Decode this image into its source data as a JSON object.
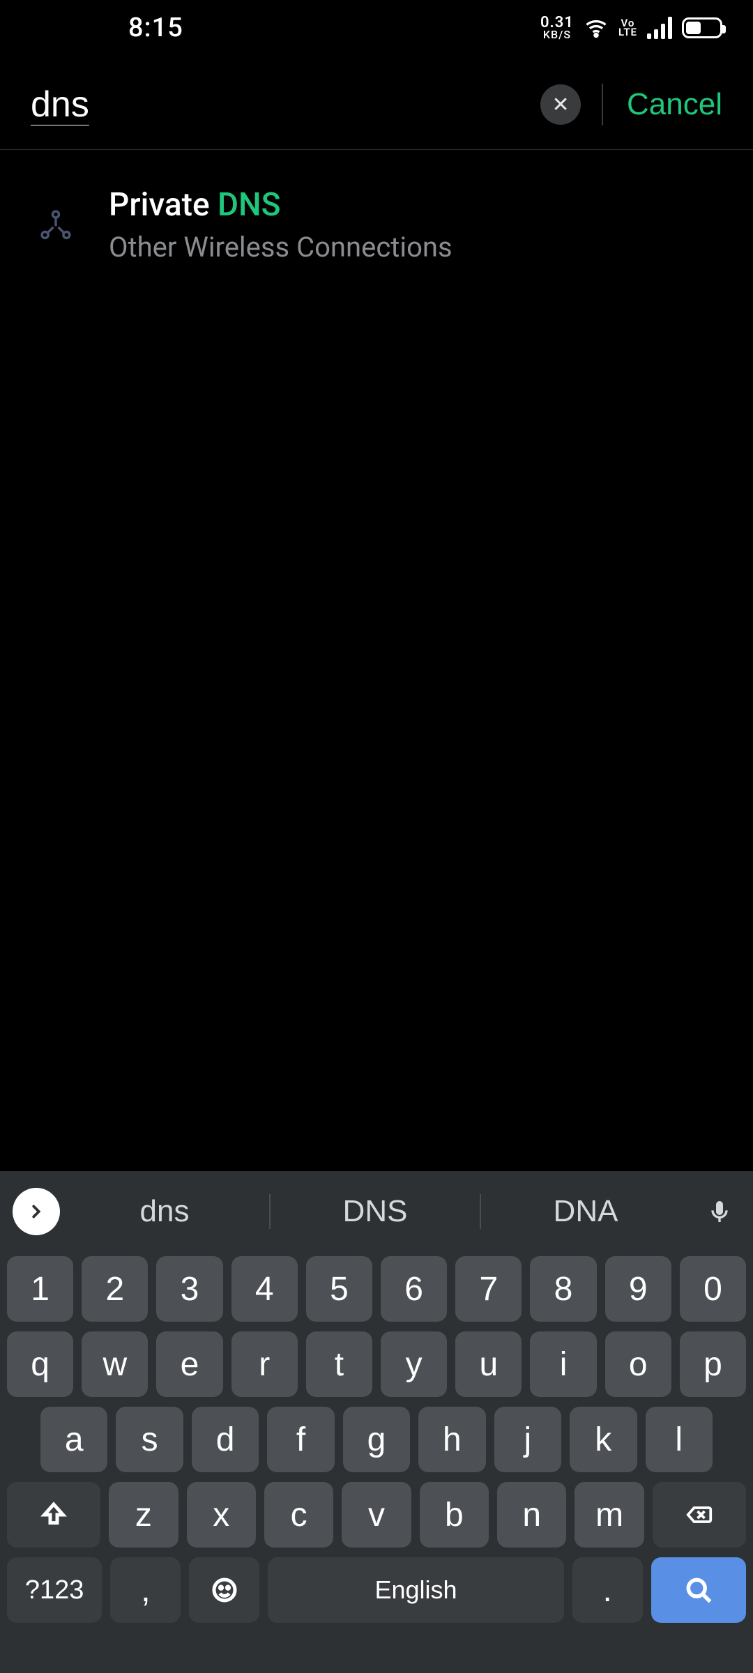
{
  "statusbar": {
    "time": "8:15",
    "data_rate": "0.31",
    "data_unit": "KB/S",
    "volte_top": "Vo",
    "volte_bot": "LTE"
  },
  "search": {
    "query": "dns",
    "cancel_label": "Cancel"
  },
  "results": [
    {
      "title_prefix": "Private ",
      "title_highlight": "DNS",
      "subtitle": "Other Wireless Connections"
    }
  ],
  "keyboard": {
    "suggestions": [
      "dns",
      "DNS",
      "DNA"
    ],
    "row_num": [
      "1",
      "2",
      "3",
      "4",
      "5",
      "6",
      "7",
      "8",
      "9",
      "0"
    ],
    "row_q": [
      "q",
      "w",
      "e",
      "r",
      "t",
      "y",
      "u",
      "i",
      "o",
      "p"
    ],
    "row_a": [
      "a",
      "s",
      "d",
      "f",
      "g",
      "h",
      "j",
      "k",
      "l"
    ],
    "row_z": [
      "z",
      "x",
      "c",
      "v",
      "b",
      "n",
      "m"
    ],
    "sym_label": "?123",
    "comma": ",",
    "period": ".",
    "space_label": "English"
  }
}
